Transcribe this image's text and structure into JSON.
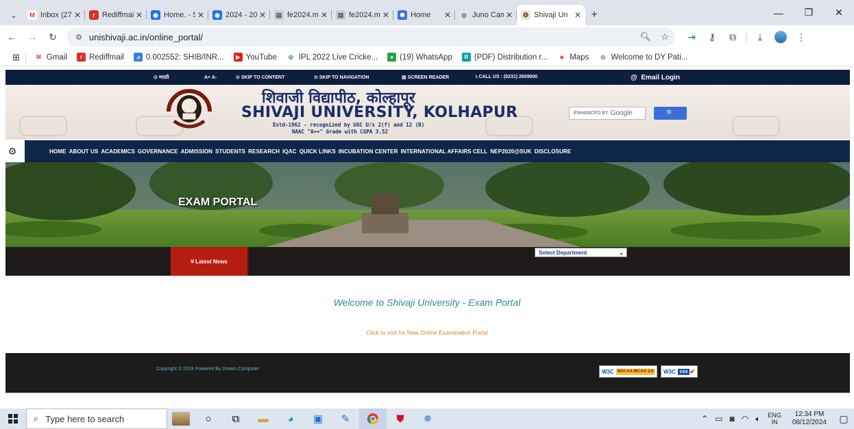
{
  "browser": {
    "tabs": [
      {
        "label": "Inbox (27",
        "fav_color": "#ffffff",
        "fav_glyph": "M",
        "fav_text_color": "#d93025"
      },
      {
        "label": "Rediffmail",
        "fav_color": "#d93025",
        "fav_glyph": "r",
        "fav_text_color": "#ffffff"
      },
      {
        "label": "Home. - S",
        "fav_color": "#1a73e8",
        "fav_glyph": "◉",
        "fav_text_color": "#ffffff"
      },
      {
        "label": "2024 - 20",
        "fav_color": "#1a73e8",
        "fav_glyph": "◉",
        "fav_text_color": "#ffffff"
      },
      {
        "label": "fe2024.m",
        "fav_color": "#c5cbd3",
        "fav_glyph": "▤",
        "fav_text_color": "#555555"
      },
      {
        "label": "fe2024.m",
        "fav_color": "#c5cbd3",
        "fav_glyph": "▤",
        "fav_text_color": "#555555"
      },
      {
        "label": "Home",
        "fav_color": "#3b6fd9",
        "fav_glyph": "✺",
        "fav_text_color": "#ffffff"
      },
      {
        "label": "Juno Cam",
        "fav_color": "#e6e9ef",
        "fav_glyph": "◎",
        "fav_text_color": "#555555"
      },
      {
        "label": "Shivaji Un",
        "fav_color": "#e9e4d8",
        "fav_glyph": "❂",
        "fav_text_color": "#6a4c1a",
        "active": true
      }
    ],
    "url": "unishivaji.ac.in/online_portal/",
    "bookmarks": [
      {
        "label": "Gmail",
        "fav_color": "#ffffff",
        "fav_glyph": "M",
        "fav_text_color": "#d93025"
      },
      {
        "label": "Rediffmail",
        "fav_color": "#d93025",
        "fav_glyph": "r",
        "fav_text_color": "#ffffff"
      },
      {
        "label": "0.002552: SHIB/INR...",
        "fav_color": "#3b7fd9",
        "fav_glyph": "⩘",
        "fav_text_color": "#ffffff"
      },
      {
        "label": "YouTube",
        "fav_color": "#e62117",
        "fav_glyph": "▶",
        "fav_text_color": "#ffffff"
      },
      {
        "label": "IPL 2022 Live Cricke...",
        "fav_color": "#ffffff",
        "fav_glyph": "◎",
        "fav_text_color": "#1e8e3e"
      },
      {
        "label": "(19) WhatsApp",
        "fav_color": "#25a244",
        "fav_glyph": "●",
        "fav_text_color": "#ffffff"
      },
      {
        "label": "(PDF) Distribution r...",
        "fav_color": "#11a0a0",
        "fav_glyph": "R",
        "fav_text_color": "#ffffff"
      },
      {
        "label": "Maps",
        "fav_color": "#ffffff",
        "fav_glyph": "⬥",
        "fav_text_color": "#ea4335"
      },
      {
        "label": "Welcome to DY Pati...",
        "fav_color": "#ffffff",
        "fav_glyph": "◎",
        "fav_text_color": "#6a6a9a"
      }
    ]
  },
  "site": {
    "topstrip": {
      "marathi": "मराठी",
      "font_size": "A+ A-",
      "skip_content": "SKIP TO CONTENT",
      "skip_navigation": "SKIP TO NAVIGATION",
      "screen_reader": "SCREEN READER",
      "call_us": "CALL US : (0231) 2609000",
      "email_login": "Email Login"
    },
    "header": {
      "title_hindi": "शिवाजी विद्यापीठ, कोल्हापूर",
      "title_english": "SHIVAJI UNIVERSITY, KOLHAPUR",
      "subtitle1": "Estd-1962 - recognized by UGC U/s 2(f) and 12 (B)",
      "subtitle2": "NAAC \"A++\" Grade with CGPA 3.52",
      "search_placeholder": "ENHANCED BY",
      "search_brand": "Google",
      "search_button": "🔍"
    },
    "nav": [
      "HOME",
      "ABOUT US",
      "ACADEMICS",
      "GOVERNANCE",
      "ADMISSION",
      "STUDENTS",
      "RESEARCH",
      "IQAC",
      "QUICK LINKS",
      "INCUBATION CENTER",
      "INTERNATIONAL AFFAIRS CELL",
      "NEP2020@SUK",
      "DISCLOSURE"
    ],
    "banner_title": "EXAM PORTAL",
    "latest_news": "Latest News",
    "department_select": "Select Department",
    "welcome": "Welcome to Shivaji University - Exam Portal",
    "visit_link": "Click to visit for New Online Examination Portal",
    "copyright": "Copyright © 2019 Powered By Dream Computer",
    "w3c_wai": "WAI-AA WCAG 2.0",
    "w3c_css": "css",
    "w3c_label": "W3C",
    "footer_sep": "/"
  },
  "taskbar": {
    "search_placeholder": "Type here to search",
    "lang_top": "ENG",
    "lang_bottom": "IN",
    "time": "12:34 PM",
    "date": "08/12/2024"
  }
}
